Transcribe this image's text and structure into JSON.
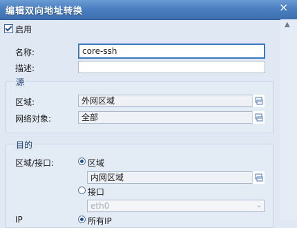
{
  "window": {
    "title": "编辑双向地址转换",
    "close_glyph": "×",
    "scroll_up_glyph": "▲"
  },
  "enable": {
    "label": "启用",
    "checked": true
  },
  "name": {
    "label": "名称:",
    "value": "core-ssh"
  },
  "description": {
    "label": "描述:",
    "value": ""
  },
  "source": {
    "title": "源",
    "zone": {
      "label": "区域:",
      "value": "外网区域"
    },
    "network_object": {
      "label": "网络对象:",
      "value": "全部"
    }
  },
  "destination": {
    "title": "目的",
    "zone_interface": {
      "label": "区域/接口:"
    },
    "option_zone": {
      "label": "区域",
      "checked": true
    },
    "zone_value": "内网区域",
    "option_interface": {
      "label": "接口",
      "checked": false
    },
    "interface_value": "eth0",
    "dropdown_glyph": "⌄",
    "cut_off_label": "IP",
    "cut_off_option": "所有IP"
  }
}
